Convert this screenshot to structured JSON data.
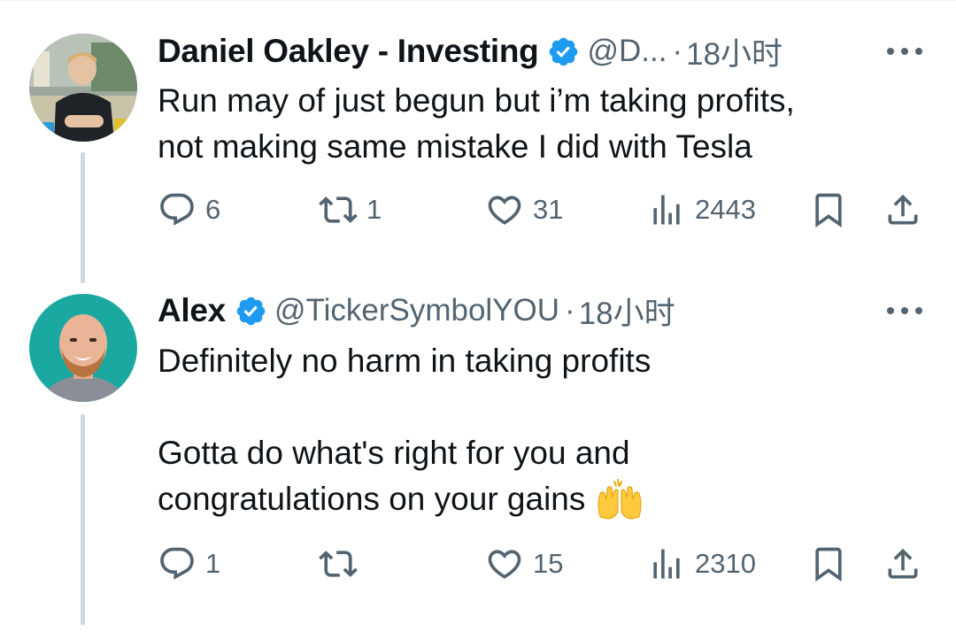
{
  "tweets": [
    {
      "display_name": "Daniel Oakley - Investing",
      "handle": "@D...",
      "separator": "·",
      "time": "18小时",
      "text_lines": [
        "Run may of just begun but i’m taking profits,",
        "not making same mistake I did with Tesla"
      ],
      "reply_count": "6",
      "retweet_count": "1",
      "like_count": "31",
      "view_count": "2443"
    },
    {
      "display_name": "Alex",
      "handle": "@TickerSymbolYOU",
      "separator": "·",
      "time": "18小时",
      "text_lines": [
        "Definitely no harm in taking profits",
        "",
        "Gotta do what's right for you and",
        "congratulations on your gains"
      ],
      "emoji": "raising-hands-emoji",
      "reply_count": "1",
      "retweet_count": "",
      "like_count": "15",
      "view_count": "2310"
    }
  ],
  "icons": {
    "verified": "verified-badge-icon",
    "more": "more-icon",
    "reply": "reply-icon",
    "retweet": "retweet-icon",
    "like": "heart-icon",
    "views": "views-icon",
    "bookmark": "bookmark-icon",
    "share": "share-icon"
  },
  "colors": {
    "verified_blue": "#1d9bf0",
    "text_primary": "#0f1419",
    "text_secondary": "#536471",
    "thread_line": "#cfd9de"
  }
}
